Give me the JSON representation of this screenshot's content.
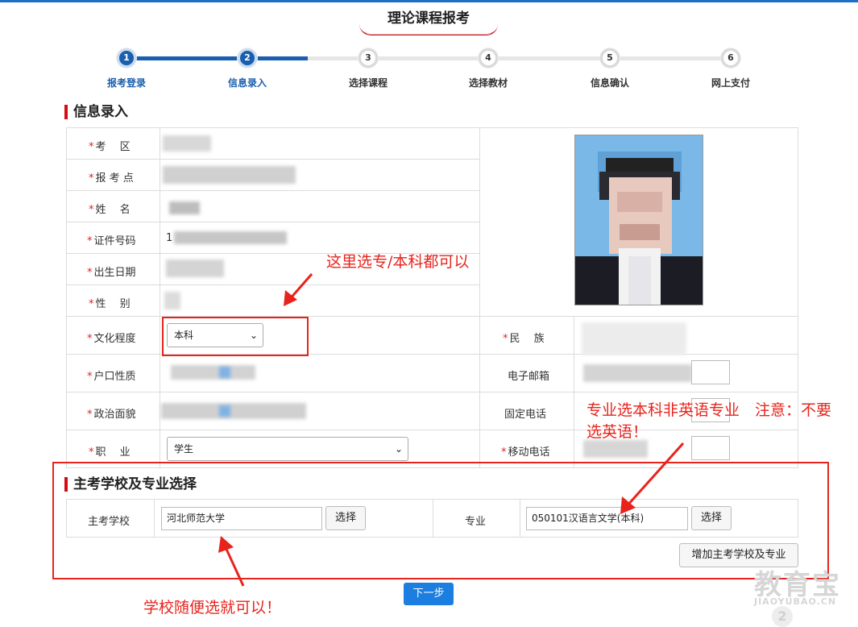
{
  "header": {
    "title": "理论课程报考"
  },
  "steps": [
    {
      "num": "1",
      "label": "报考登录",
      "active": true
    },
    {
      "num": "2",
      "label": "信息录入",
      "active": true
    },
    {
      "num": "3",
      "label": "选择课程",
      "active": false
    },
    {
      "num": "4",
      "label": "选择教材",
      "active": false
    },
    {
      "num": "5",
      "label": "信息确认",
      "active": false
    },
    {
      "num": "6",
      "label": "网上支付",
      "active": false
    }
  ],
  "info_section": {
    "title": "信息录入",
    "fields": {
      "exam_area": "考　 区",
      "exam_site": "报 考 点",
      "name": "姓　 名",
      "id_number": "证件号码",
      "birth_date": "出生日期",
      "gender": "性　 别",
      "education": "文化程度",
      "ethnicity": "民　 族",
      "household": "户口性质",
      "email": "电子邮箱",
      "political": "政治面貌",
      "landline": "固定电话",
      "occupation": "职　 业",
      "mobile": "移动电话"
    },
    "values": {
      "id_number_prefix": "1",
      "education_selected": "本科",
      "occupation_selected": "学生"
    },
    "required_mark": "*"
  },
  "school_section": {
    "title": "主考学校及专业选择",
    "school_label": "主考学校",
    "school_value": "河北师范大学",
    "select_label": "选择",
    "major_label": "专业",
    "major_value": "050101汉语言文学(本科)",
    "add_button": "增加主考学校及专业"
  },
  "next_button": "下一步",
  "annotations": {
    "note1": "这里选专/本科都可以",
    "note2_line1": "专业选本科非英语专业　注意：不要",
    "note2_line2": "选英语！",
    "note3": "学校随便选就可以！"
  },
  "watermark": {
    "text": "教育宝",
    "sub": "JIAOYUBAO.CN",
    "page": "2"
  },
  "colors": {
    "accent": "#1a5fae",
    "annotation": "#e8231c",
    "section_bar": "#d40d12",
    "next_button": "#1b7ee0"
  }
}
